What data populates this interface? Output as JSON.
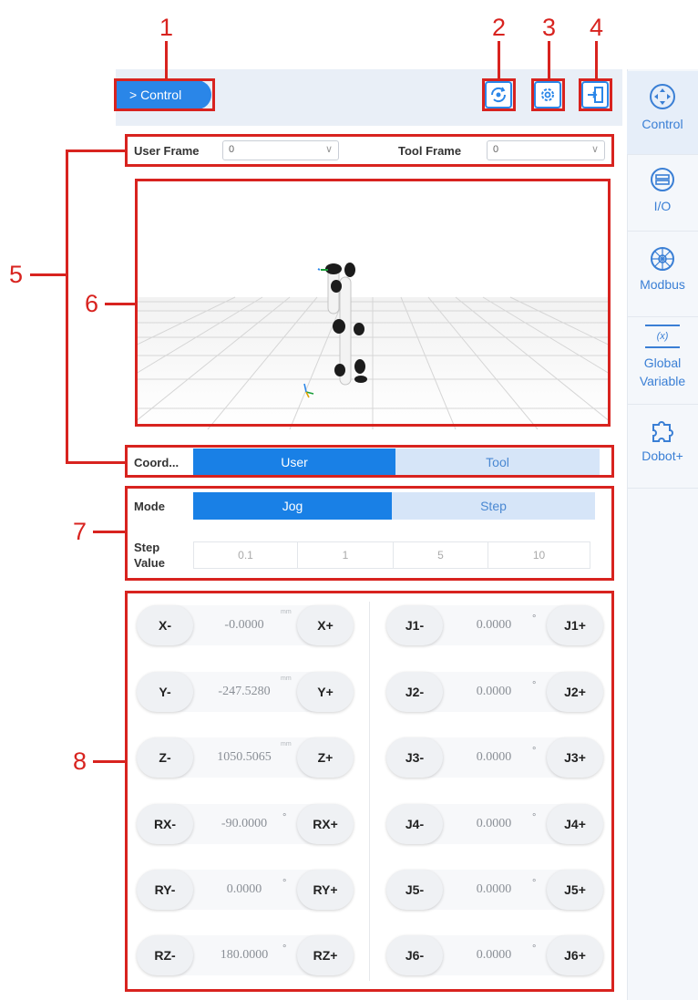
{
  "annotations": [
    "1",
    "2",
    "3",
    "4",
    "5",
    "6",
    "7",
    "8"
  ],
  "header": {
    "control_label": "> Control"
  },
  "sidebar": {
    "items": [
      {
        "label": "Control",
        "icon": "control-icon"
      },
      {
        "label": "I/O",
        "icon": "io-icon"
      },
      {
        "label": "Modbus",
        "icon": "modbus-icon"
      },
      {
        "label": "Global Variable",
        "icon": "global-variable-icon",
        "badge": "(x)"
      },
      {
        "label": "Dobot+",
        "icon": "puzzle-icon"
      }
    ]
  },
  "frames": {
    "user_frame_label": "User Frame",
    "user_frame_value": "0",
    "tool_frame_label": "Tool Frame",
    "tool_frame_value": "0"
  },
  "coord": {
    "label": "Coord...",
    "options": [
      "User",
      "Tool"
    ],
    "selected": "User"
  },
  "mode": {
    "label": "Mode",
    "options": [
      "Jog",
      "Step"
    ],
    "selected": "Jog"
  },
  "step": {
    "label_line1": "Step",
    "label_line2": "Value",
    "values": [
      "0.1",
      "1",
      "5",
      "10"
    ]
  },
  "cartesian": [
    {
      "minus": "X-",
      "value": "-0.0000",
      "unit": "mm",
      "plus": "X+"
    },
    {
      "minus": "Y-",
      "value": "-247.5280",
      "unit": "mm",
      "plus": "Y+"
    },
    {
      "minus": "Z-",
      "value": "1050.5065",
      "unit": "mm",
      "plus": "Z+"
    },
    {
      "minus": "RX-",
      "value": "-90.0000",
      "unit": "°",
      "plus": "RX+"
    },
    {
      "minus": "RY-",
      "value": "0.0000",
      "unit": "°",
      "plus": "RY+"
    },
    {
      "minus": "RZ-",
      "value": "180.0000",
      "unit": "°",
      "plus": "RZ+"
    }
  ],
  "joints": [
    {
      "minus": "J1-",
      "value": "0.0000",
      "unit": "°",
      "plus": "J1+"
    },
    {
      "minus": "J2-",
      "value": "0.0000",
      "unit": "°",
      "plus": "J2+"
    },
    {
      "minus": "J3-",
      "value": "0.0000",
      "unit": "°",
      "plus": "J3+"
    },
    {
      "minus": "J4-",
      "value": "0.0000",
      "unit": "°",
      "plus": "J4+"
    },
    {
      "minus": "J5-",
      "value": "0.0000",
      "unit": "°",
      "plus": "J5+"
    },
    {
      "minus": "J6-",
      "value": "0.0000",
      "unit": "°",
      "plus": "J6+"
    }
  ],
  "colors": {
    "accent": "#1980e6",
    "annotation": "#d8231f",
    "segment_off": "#d6e5f8"
  }
}
